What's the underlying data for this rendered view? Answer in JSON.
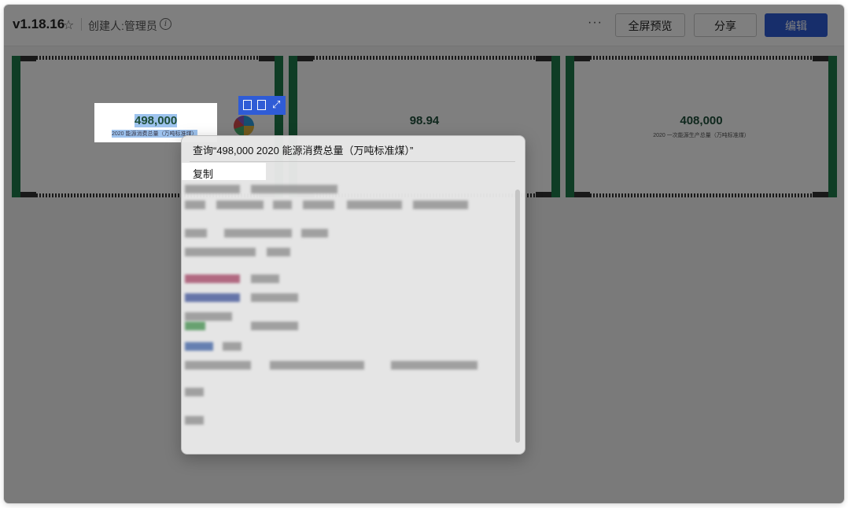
{
  "topbar": {
    "version": "v1.18.16",
    "creator": "创建人:管理员",
    "more": "···",
    "buttons": {
      "preview": "全屏预览",
      "share": "分享",
      "edit": "编辑"
    }
  },
  "cards": [
    {
      "value": "498,000",
      "label": "2020 能源消费总量（万吨标准煤）"
    },
    {
      "value": "98.94",
      "label": ""
    },
    {
      "value": "408,000",
      "label": "2020 一次能源生产总量（万吨标准煤）"
    }
  ],
  "context_menu": {
    "query": "查询“498,000 2020 能源消费总量（万吨标准煤）”",
    "copy": "复制"
  },
  "colors": {
    "accent": "#2f5cd6",
    "card_border": "#1f7a4a",
    "kpi_text": "#1f4f3a",
    "selection": "#9ec3ee"
  },
  "icons": [
    "star-icon",
    "info-icon",
    "export-icon",
    "search-icon",
    "expand-icon"
  ]
}
